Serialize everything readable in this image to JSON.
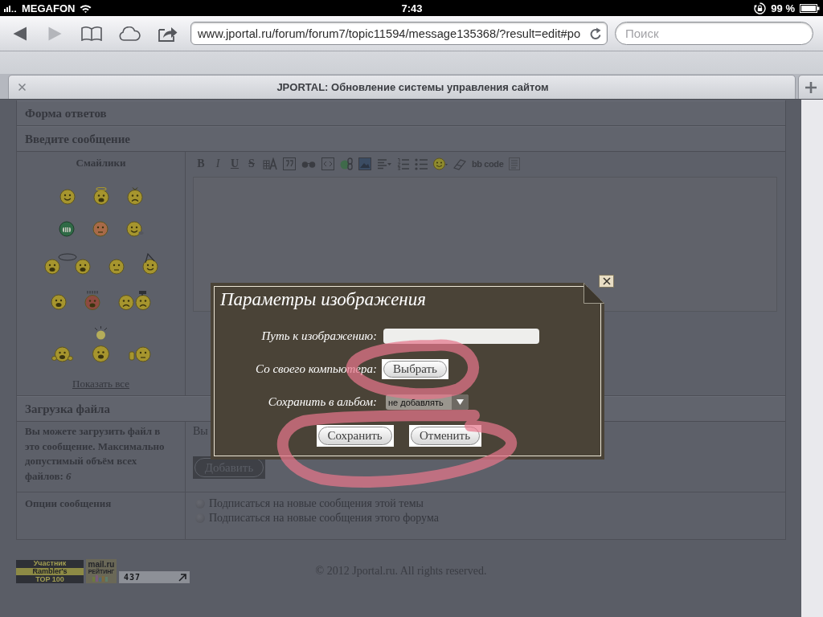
{
  "status_bar": {
    "carrier": "MEGAFON",
    "time": "7:43",
    "battery": "99 %"
  },
  "browser": {
    "url": "www.jportal.ru/forum/forum7/topic11594/message135368/?result=edit#po",
    "search": {
      "placeholder": "Поиск"
    },
    "tab": {
      "title": "JPORTAL: Обновление системы управления сайтом"
    }
  },
  "reply_form": {
    "title": "Форма ответов",
    "message_header": "Введите сообщение",
    "smileys": {
      "title": "Смайлики",
      "show_all": "Показать все"
    },
    "toolbar": [
      "B",
      "I",
      "U",
      "S"
    ],
    "bb_code": "bb code"
  },
  "upload": {
    "title": "Загрузка файла",
    "info": "Вы можете загрузить файл в это сообщение. Максимально допустимый объём всех файлов: *6*",
    "hint": "Вы",
    "add_button": "Добавить"
  },
  "options": {
    "title": "Опции сообщения",
    "items": [
      {
        "label": "Подписаться на новые сообщения этой темы",
        "checked": false
      },
      {
        "label": "Подписаться на новые сообщения этого форума",
        "checked": false
      }
    ]
  },
  "footer": {
    "rambler_badge": [
      "Участник",
      "Rambler's",
      "TOP 100"
    ],
    "mailru_badge": [
      "mail.ru",
      "РЕЙТИНГ"
    ],
    "hit_counter": "437",
    "copyright": "© 2012 Jportal.ru. All rights reserved."
  },
  "dialog": {
    "title": "Параметры изображения",
    "fields": [
      {
        "kind": "input",
        "label": "Путь к изображению:"
      },
      {
        "kind": "button",
        "label": "Со своего компьютера:",
        "button": "Выбрать"
      },
      {
        "kind": "select",
        "label": "Сохранить в альбом:",
        "value": "не добавлять"
      }
    ],
    "buttons": [
      "Сохранить",
      "Отменить"
    ]
  }
}
